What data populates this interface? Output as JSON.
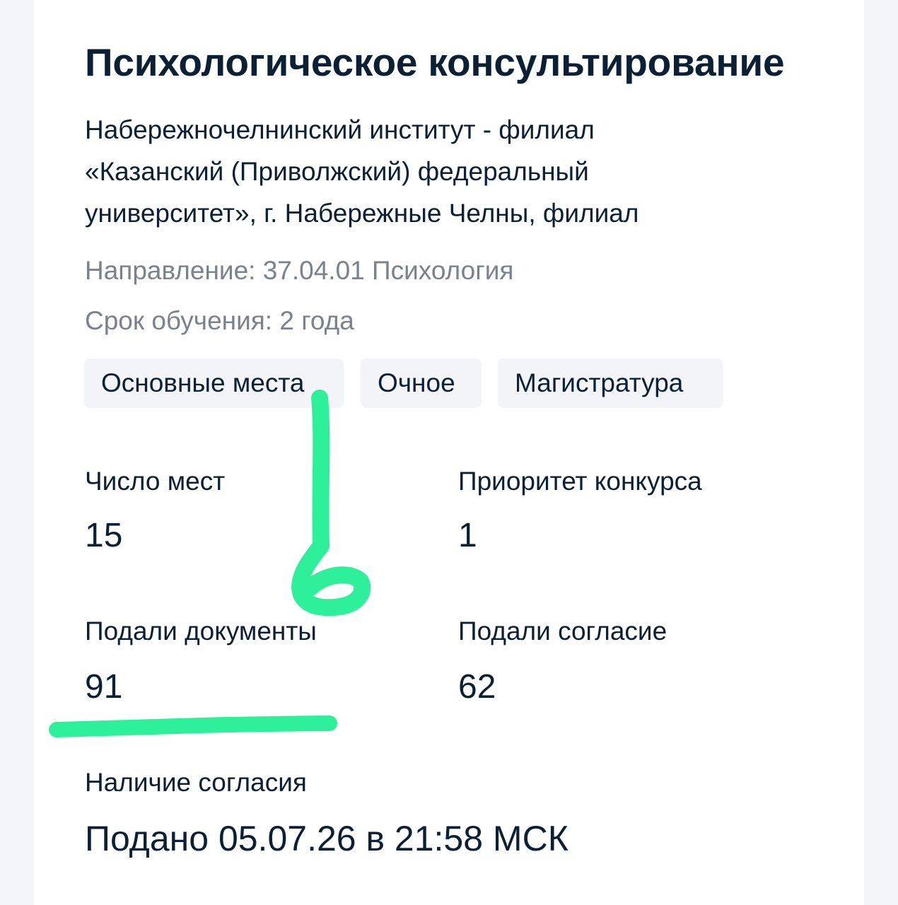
{
  "program": {
    "title": "Психологическое консультирование",
    "institution_lines": [
      "Набережночелнинский институт - филиал",
      "«Казанский (Приволжский) федеральный",
      "университет», г. Набережные Челны, филиал"
    ],
    "direction": "Направление: 37.04.01 Психология",
    "duration": "Срок обучения: 2 года"
  },
  "tags": [
    "Основные места",
    "Очное",
    "Магистратура"
  ],
  "stats": {
    "places": {
      "label": "Число мест",
      "value": "15"
    },
    "priority": {
      "label": "Приоритет конкурса",
      "value": "1"
    },
    "documents": {
      "label": "Подали документы",
      "value": "91"
    },
    "consents": {
      "label": "Подали согласие",
      "value": "62"
    }
  },
  "consent": {
    "label": "Наличие согласия",
    "value": "Подано 05.07.26 в 21:58 МСК"
  },
  "annotation": {
    "color": "#2ff09a",
    "note": "6"
  }
}
